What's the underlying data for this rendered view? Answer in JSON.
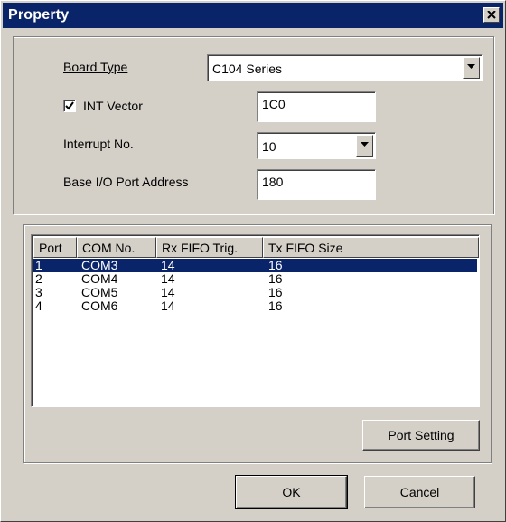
{
  "window": {
    "title": "Property",
    "close_glyph": "close-icon"
  },
  "settings": {
    "board_type_label": "Board Type",
    "board_type_value": "C104 Series",
    "int_vector_label": "INT Vector",
    "int_vector_checked": true,
    "int_vector_value": "1C0",
    "interrupt_label": "Interrupt No.",
    "interrupt_value": "10",
    "base_io_label": "Base I/O Port Address",
    "base_io_value": "180"
  },
  "ports": {
    "columns": [
      "Port",
      "COM No.",
      "Rx FIFO Trig.",
      "Tx FIFO Size"
    ],
    "rows": [
      {
        "port": "1",
        "com": "COM3",
        "rx": "14",
        "tx": "16",
        "selected": true
      },
      {
        "port": "2",
        "com": "COM4",
        "rx": "14",
        "tx": "16",
        "selected": false
      },
      {
        "port": "3",
        "com": "COM5",
        "rx": "14",
        "tx": "16",
        "selected": false
      },
      {
        "port": "4",
        "com": "COM6",
        "rx": "14",
        "tx": "16",
        "selected": false
      }
    ],
    "port_setting_label": "Port Setting"
  },
  "footer": {
    "ok_label": "OK",
    "cancel_label": "Cancel"
  },
  "colors": {
    "face": "#d4d0c8",
    "titlebar": "#0a246a",
    "selection": "#0a246a"
  }
}
